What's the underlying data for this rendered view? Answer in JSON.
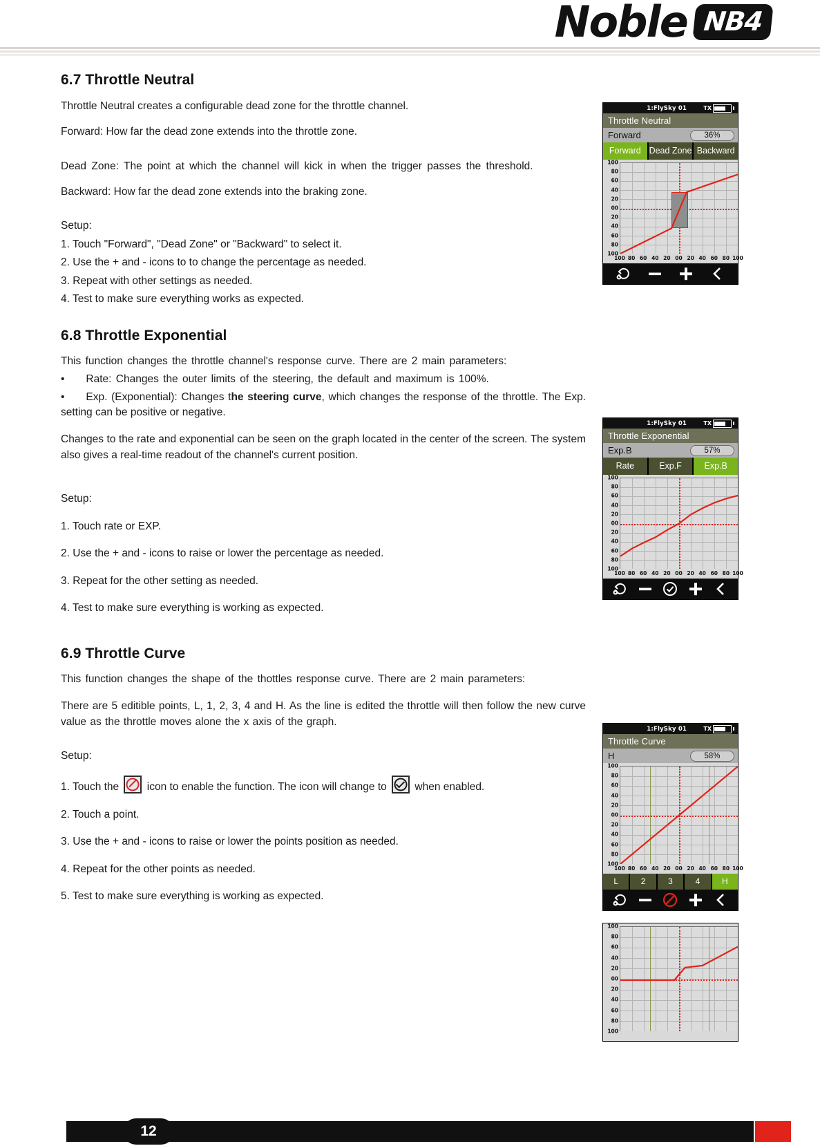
{
  "header": {
    "logo_word": "Noble",
    "logo_badge": "NB4"
  },
  "footer": {
    "page_number": "12"
  },
  "sections": [
    {
      "id": "6.7",
      "heading": "6.7 Throttle Neutral",
      "paragraphs": [
        "Throttle Neutral creates a configurable dead zone for the throttle channel.",
        "Forward: How far the dead zone extends into the throttle zone.",
        "Dead Zone: The point at which the channel will kick in when the trigger passes the threshold.",
        "Backward: How far the dead zone extends into the braking zone."
      ],
      "setup_label": "Setup:",
      "steps": [
        "1. Touch \"Forward\", \"Dead Zone\" or \"Backward\" to select it.",
        "2. Use the + and - icons to to change the percentage as needed.",
        "3. Repeat with other settings as needed.",
        "4. Test to make sure everything works as expected."
      ]
    },
    {
      "id": "6.8",
      "heading": "6.8 Throttle Exponential",
      "paragraphs": [
        "This function changes the throttle channel's response curve. There are 2 main parameters:",
        "•  Rate: Changes the outer limits of the steering, the default and maximum is 100%.",
        "Changes to the rate and exponential can be seen on the graph located in the center of the screen. The system also gives a real-time readout of the channel's current position."
      ],
      "bullet_exp": {
        "prefix": "•  Exp. (Exponential): Changes t",
        "bold": "he steering curve",
        "suffix": ", which changes the response of the throttle. The Exp. setting can be positive or negative."
      },
      "setup_label": "Setup:",
      "steps": [
        "1. Touch rate or EXP.",
        "2. Use the + and - icons to raise or lower the percentage as needed.",
        "3. Repeat for the other setting as needed.",
        "4. Test to make sure everything is working as expected."
      ]
    },
    {
      "id": "6.9",
      "heading": "6.9 Throttle Curve",
      "paragraphs": [
        "This function changes the shape of the thottles response curve. There are 2 main parameters:",
        "There are 5 editible points, L, 1, 2, 3, 4 and H. As the line is edited the throttle will then follow the new curve value as the throttle moves alone the x axis of the graph."
      ],
      "setup_label": "Setup:",
      "step1": {
        "a": "1. Touch the",
        "b": "icon to enable the function. The icon will change to",
        "c": "when enabled."
      },
      "steps": [
        "2. Touch a point.",
        "3. Use the + and - icons to raise or lower the points position as needed.",
        "4. Repeat for the other points as needed.",
        "5. Test to make sure everything is working as expected."
      ]
    }
  ],
  "devices": [
    {
      "name": "throttle-neutral-screen",
      "status_model": "1:FlySky 01",
      "status_tx": "TX",
      "title": "Throttle Neutral",
      "param_label": "Forward",
      "param_value": "36%",
      "tabs": [
        {
          "label": "Forward",
          "active": true
        },
        {
          "label": "Dead Zone",
          "active": false
        },
        {
          "label": "Backward",
          "active": false
        }
      ],
      "toolbar": [
        "reset-icon",
        "minus-icon",
        "plus-icon",
        "back-icon"
      ],
      "chart_data": {
        "type": "line",
        "title": "Throttle Neutral response",
        "xlabel": "",
        "ylabel": "",
        "xlim": [
          -100,
          100
        ],
        "ylim": [
          -100,
          100
        ],
        "xticks": [
          "100",
          "80",
          "60",
          "40",
          "20",
          "00",
          "20",
          "40",
          "60",
          "80",
          "100"
        ],
        "yticks": [
          "100",
          "80",
          "60",
          "40",
          "20",
          "00",
          "20",
          "40",
          "60",
          "80",
          "100"
        ],
        "grid": true,
        "cursor_x": 0,
        "cursor_y": 0,
        "deadzone": {
          "x0": -13,
          "x1": 13,
          "y0": -44,
          "y1": 36
        },
        "points": [
          [
            -100,
            -100
          ],
          [
            -13,
            -44
          ],
          [
            13,
            36
          ],
          [
            100,
            75
          ]
        ]
      }
    },
    {
      "name": "throttle-exponential-screen",
      "status_model": "1:FlySky 01",
      "status_tx": "TX",
      "title": "Throttle Exponential",
      "param_label": "Exp.B",
      "param_value": "57%",
      "tabs": [
        {
          "label": "Rate",
          "active": false
        },
        {
          "label": "Exp.F",
          "active": false
        },
        {
          "label": "Exp.B",
          "active": true
        }
      ],
      "toolbar": [
        "reset-icon",
        "minus-icon",
        "check-icon",
        "plus-icon",
        "back-icon"
      ],
      "chart_data": {
        "type": "line",
        "title": "Throttle Exponential response",
        "xlabel": "",
        "ylabel": "",
        "xlim": [
          -100,
          100
        ],
        "ylim": [
          -100,
          100
        ],
        "xticks": [
          "100",
          "80",
          "60",
          "40",
          "20",
          "00",
          "20",
          "40",
          "60",
          "80",
          "100"
        ],
        "yticks": [
          "100",
          "80",
          "60",
          "40",
          "20",
          "00",
          "20",
          "40",
          "60",
          "80",
          "100"
        ],
        "grid": true,
        "cursor_x": 0,
        "cursor_y": 0,
        "points": [
          [
            -100,
            -72
          ],
          [
            -80,
            -55
          ],
          [
            -60,
            -42
          ],
          [
            -40,
            -30
          ],
          [
            -20,
            -14
          ],
          [
            0,
            0
          ],
          [
            20,
            20
          ],
          [
            40,
            34
          ],
          [
            60,
            46
          ],
          [
            80,
            55
          ],
          [
            100,
            62
          ]
        ]
      }
    },
    {
      "name": "throttle-curve-screen",
      "status_model": "1:FlySky 01",
      "status_tx": "TX",
      "title": "Throttle Curve",
      "param_label": "H",
      "param_value": "58%",
      "tabs": [
        {
          "label": "L",
          "active": false
        },
        {
          "label": "2",
          "active": false
        },
        {
          "label": "3",
          "active": false
        },
        {
          "label": "4",
          "active": false
        },
        {
          "label": "H",
          "active": true
        }
      ],
      "toolbar": [
        "reset-icon",
        "minus-icon",
        "disabled-icon",
        "plus-icon",
        "back-icon"
      ],
      "chart_data": {
        "type": "line",
        "title": "Throttle Curve response",
        "xlabel": "",
        "ylabel": "",
        "xlim": [
          -100,
          100
        ],
        "ylim": [
          -100,
          100
        ],
        "xticks": [
          "100",
          "80",
          "60",
          "40",
          "20",
          "00",
          "20",
          "40",
          "60",
          "80",
          "100"
        ],
        "yticks": [
          "100",
          "80",
          "60",
          "40",
          "20",
          "00",
          "20",
          "40",
          "60",
          "80",
          "100"
        ],
        "grid": true,
        "cursor_x": 0,
        "cursor_y": 0,
        "points": [
          [
            -100,
            -100
          ],
          [
            0,
            0
          ],
          [
            100,
            100
          ]
        ]
      }
    },
    {
      "name": "throttle-curve-graph-only",
      "chart_data": {
        "type": "line",
        "title": "Edited throttle curve",
        "xlim": [
          -100,
          100
        ],
        "ylim": [
          -100,
          100
        ],
        "yticks": [
          "100",
          "80",
          "60",
          "40",
          "20",
          "00",
          "20",
          "40",
          "60",
          "80",
          "100"
        ],
        "grid": true,
        "cursor_x": 0,
        "cursor_y": 0,
        "points": [
          [
            -100,
            -2
          ],
          [
            -8,
            -2
          ],
          [
            10,
            22
          ],
          [
            40,
            26
          ],
          [
            100,
            62
          ]
        ]
      }
    }
  ]
}
